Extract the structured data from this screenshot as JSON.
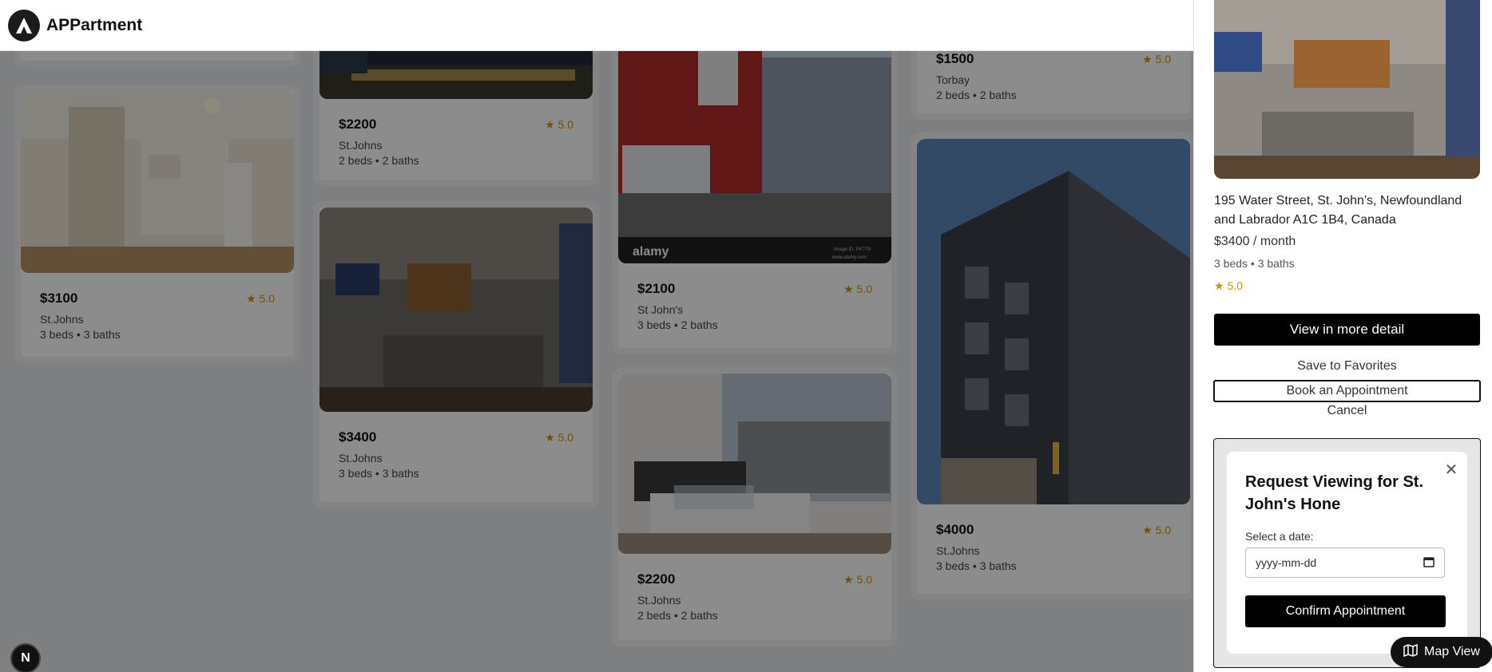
{
  "app": {
    "title": "APPartment"
  },
  "listings": [
    {
      "price": "",
      "rating": "",
      "location": "",
      "beds": ""
    },
    {
      "price": "$3100",
      "rating": "★ 5.0",
      "location": "St.Johns",
      "beds": "3 beds • 3 baths"
    },
    {
      "price": "$2200",
      "rating": "★ 5.0",
      "location": "St.Johns",
      "beds": "2 beds • 2 baths"
    },
    {
      "price": "$3400",
      "rating": "★ 5.0",
      "location": "St.Johns",
      "beds": "3 beds • 3 baths"
    },
    {
      "price": "$2100",
      "rating": "★ 5.0",
      "location": "St John's",
      "beds": "3 beds • 2 baths"
    },
    {
      "price": "$2200",
      "rating": "★ 5.0",
      "location": "St.Johns",
      "beds": "2 beds • 2 baths"
    },
    {
      "price": "$1500",
      "rating": "★ 5.0",
      "location": "Torbay",
      "beds": "2 beds • 2 baths"
    },
    {
      "price": "$4000",
      "rating": "★ 5.0",
      "location": "St.Johns",
      "beds": "3 beds • 3 baths"
    }
  ],
  "photo_watermark": {
    "brand": "alamy",
    "image_id": "Image ID: PK7T8",
    "site": "www.alamy.com"
  },
  "detail": {
    "address": "195 Water Street, St. John's, Newfoundland and Labrador A1C 1B4, Canada",
    "price": "$3400 / month",
    "beds": "3 beds • 3 baths",
    "rating": "★ 5.0",
    "view_detail_label": "View in more detail",
    "save_label": "Save to Favorites",
    "book_label": "Book an Appointment",
    "cancel_label": "Cancel"
  },
  "booking": {
    "title": "Request Viewing for St. John's Hone",
    "date_label": "Select a date:",
    "date_placeholder": "yyyy-mm-dd",
    "confirm_label": "Confirm Appointment",
    "close_icon": "close-icon"
  },
  "map_view_label": "Map View",
  "dev_badge": "N"
}
